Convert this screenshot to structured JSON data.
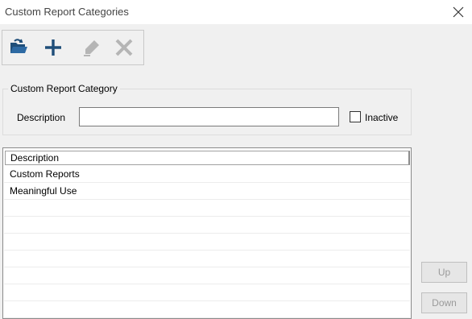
{
  "window": {
    "title": "Custom Report Categories",
    "close_icon": "close-icon"
  },
  "toolbar": {
    "buttons": [
      {
        "name": "open-folder",
        "icon": "folder-open-icon",
        "enabled": true
      },
      {
        "name": "add",
        "icon": "plus-icon",
        "enabled": true
      },
      {
        "name": "edit",
        "icon": "pencil-icon",
        "enabled": false
      },
      {
        "name": "delete",
        "icon": "x-delete-icon",
        "enabled": false
      }
    ]
  },
  "group": {
    "legend": "Custom Report Category",
    "description_label": "Description",
    "description_value": "",
    "inactive_label": "Inactive",
    "inactive_checked": false
  },
  "grid": {
    "header": "Description",
    "rows": [
      "Custom Reports",
      "Meaningful Use",
      "",
      "",
      "",
      "",
      "",
      "",
      ""
    ]
  },
  "side_buttons": {
    "up": "Up",
    "down": "Down"
  },
  "colors": {
    "accent": "#1f4e79",
    "disabled": "#9a9a9a"
  }
}
